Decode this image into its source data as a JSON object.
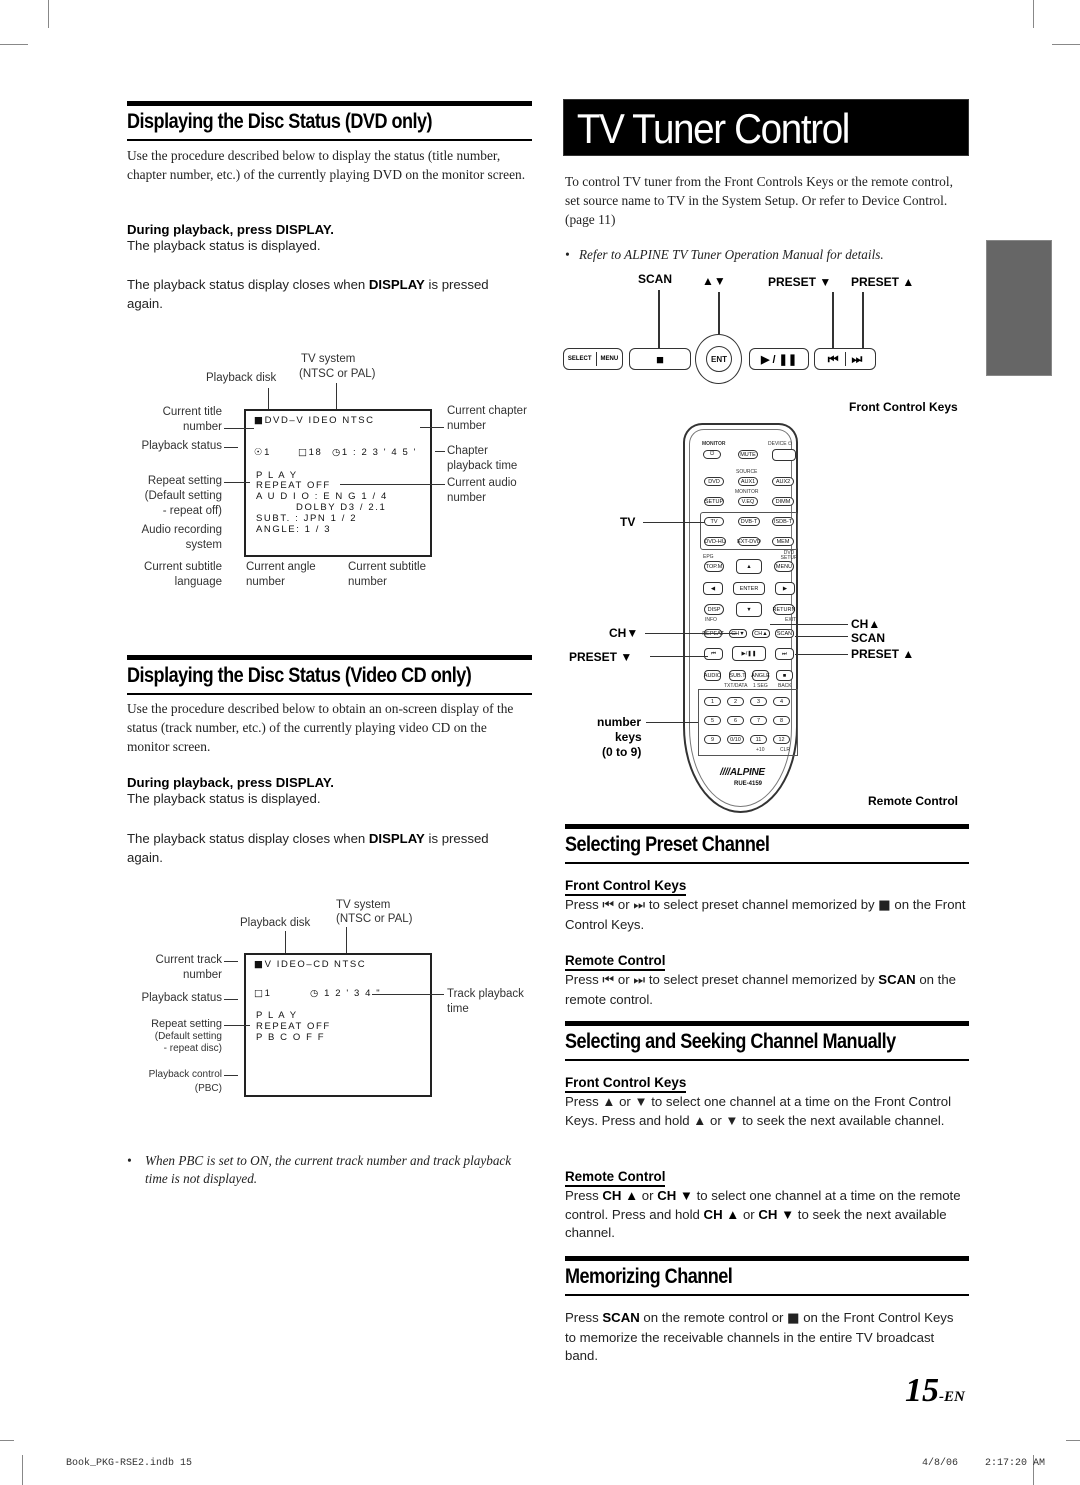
{
  "page": {
    "number": "15",
    "suffix": "-EN"
  },
  "footer": {
    "file": "Book_PKG-RSE2.indb   15",
    "date": "4/8/06",
    "time": "2:17:20 AM"
  },
  "left": {
    "dvd": {
      "heading": "Displaying the Disc Status (DVD only)",
      "intro": "Use the procedure described below to display the status (title number, chapter number, etc.) of the currently playing DVD on the monitor screen.",
      "step_prefix": "During playback, press ",
      "step_key": "DISPLAY.",
      "step_result": "The playback status is displayed.",
      "close_prefix": "The playback status display closes when ",
      "close_key": "DISPLAY",
      "close_suffix": " is pressed again.",
      "diagram": {
        "osd_lines": [
          "DVD–V IDEO  NTSC",
          "1",
          "18",
          "1 : 2 3 ' 4 5 '",
          "P L A Y",
          "REPEAT  OFF",
          "A U D I O : E N G  1 / 4",
          "DOLBY  D3 / 2.1",
          "SUBT. : JPN  1 / 2",
          "ANGLE: 1 / 3"
        ],
        "labels": {
          "tv_system": "TV system",
          "tv_system_sub": "(NTSC or PAL)",
          "playback_disk": "Playback disk",
          "current_title": "Current title",
          "current_title_2": "number",
          "playback_status": "Playback status",
          "repeat_setting": "Repeat setting",
          "repeat_default": "(Default setting",
          "repeat_default_2": "- repeat off)",
          "audio_rec": "Audio recording",
          "audio_rec_2": "system",
          "cur_sub_lang": "Current subtitle",
          "cur_sub_lang_2": "language",
          "cur_angle": "Current angle",
          "cur_angle_2": "number",
          "cur_sub_num": "Current subtitle",
          "cur_sub_num_2": "number",
          "cur_chapter": "Current chapter",
          "cur_chapter_2": "number",
          "chapter_time": "Chapter",
          "chapter_time_2": "playback time",
          "cur_audio": "Current audio",
          "cur_audio_2": "number"
        }
      }
    },
    "vcd": {
      "heading": "Displaying the Disc Status (Video CD only)",
      "intro": "Use the procedure described below to obtain an on-screen display of the status (track number, etc.) of the currently playing video CD on the monitor screen.",
      "step_prefix": "During playback, press ",
      "step_key": "DISPLAY.",
      "step_result": "The playback status is displayed.",
      "close_prefix": "The playback status display closes when ",
      "close_key": "DISPLAY",
      "close_suffix": " is pressed again.",
      "diagram": {
        "osd_lines": [
          "V IDEO–CD",
          "NTSC",
          "1",
          "1 2 ' 3 4 \"",
          "P L A Y",
          "REPEAT  OFF",
          "P B C    O F F"
        ],
        "labels": {
          "tv_system": "TV system",
          "tv_system_sub": "(NTSC or PAL)",
          "playback_disk": "Playback disk",
          "cur_track": "Current track",
          "cur_track_2": "number",
          "playback_status": "Playback status",
          "repeat_setting": "Repeat setting",
          "repeat_default": "(Default setting",
          "repeat_default_2": "- repeat disc)",
          "pbc": "Playback control",
          "pbc_2": "(PBC)",
          "track_time": "Track playback",
          "track_time_2": "time"
        }
      },
      "note": "When PBC is set to ON, the current track number and track playback time is not displayed."
    }
  },
  "right": {
    "title": "TV Tuner Control",
    "intro": "To control TV tuner from the Front Controls Keys or the remote control, set source name to TV in the System Setup. Or refer to Device Control. (page 11)",
    "note": "Refer to ALPINE TV Tuner Operation Manual for details.",
    "front_keys": {
      "caption": "Front Control Keys",
      "labels": {
        "scan": "SCAN",
        "updown": "▲▼",
        "preset_down": "PRESET ▼",
        "preset_up": "PRESET ▲"
      },
      "buttons": {
        "select": "SELECT",
        "menu": "MENU",
        "stop": "■",
        "ent": "ENT",
        "play_pause": "▶ / ❚❚",
        "prev": "⏮",
        "next": "⏭"
      }
    },
    "remote": {
      "caption": "Remote Control",
      "brand": "////ALPINE",
      "model": "RUE-4159",
      "callouts": {
        "tv": "TV",
        "ch_down": "CH▼",
        "preset_down": "PRESET ▼",
        "number_keys": "number",
        "number_keys_2": "keys",
        "number_keys_3": "(0 to 9)",
        "ch_up": "CH▲",
        "scan": "SCAN",
        "preset_up": "PRESET ▲"
      },
      "keys": {
        "monitor": "MONITOR",
        "device": "DEVICE ⏻",
        "power": "⏻",
        "mute": "MUTE",
        "source": "SOURCE",
        "dvd": "DVD",
        "aux1": "AUX1",
        "aux2": "AUX2",
        "monitor2": "MONITOR",
        "setup": "SETUP",
        "veq": "V.EQ",
        "dimm": "DIMM",
        "tv": "TV",
        "dvbt": "DVB-T",
        "isdbt": "ISDB-T",
        "dvdhu": "DVD-HU",
        "extdvd": "EXT-DVD",
        "mem": "MEM",
        "epg": "EPG",
        "dvdsetup": "DVD SETUP",
        "topm": "TOP.M",
        "up": "▲",
        "menu": "MENU",
        "left": "◀",
        "enter": "ENTER",
        "right": "▶",
        "disp": "DISP",
        "down": "▼",
        "return": "RETURN",
        "info": "INFO",
        "exit": "EXIT",
        "repeat": "REPEAT",
        "chdown": "CH▼",
        "chup": "CH▲",
        "scan": "SCAN",
        "prev": "⏮",
        "playpause": "▶/❚❚",
        "next": "⏭",
        "audio": "AUDIO",
        "subt": "SUB.T",
        "angle": "ANGLE",
        "stop": "■",
        "txtdata": "TXT/DATA",
        "oneseg": "1 SEG",
        "back": "BACK",
        "numbers": [
          "1",
          "2",
          "3",
          "4",
          "5",
          "6",
          "7",
          "8",
          "9",
          "0/10",
          "11",
          "12"
        ],
        "plus10": "+10",
        "clr": "CLR"
      }
    },
    "preset": {
      "heading": "Selecting Preset Channel",
      "front_head": "Front Control Keys",
      "front_text_1": "Press ",
      "front_or": " or ",
      "front_text_2": " to select preset channel memorized by ",
      "front_text_3": " on the Front Control Keys.",
      "remote_head": "Remote Control",
      "remote_text_1": "Press ",
      "remote_or": " or ",
      "remote_text_2": " to select preset channel memorized by ",
      "remote_key": "SCAN",
      "remote_text_3": " on the remote control."
    },
    "seek": {
      "heading": "Selecting and Seeking Channel Manually",
      "front_head": "Front Control Keys",
      "front_text": "Press ▲ or ▼  to select one channel at a time on the Front Control Keys. Press and hold ▲ or ▼ to seek the next available channel.",
      "remote_head": "Remote Control",
      "remote_p1": "Press ",
      "remote_k1": "CH ▲",
      "remote_p2": " or ",
      "remote_k2": "CH ▼",
      "remote_p3": " to select one channel at a time on the remote control. Press and hold ",
      "remote_k3": "CH ▲",
      "remote_p4": " or ",
      "remote_k4": "CH ▼",
      "remote_p5": " to seek the next available channel."
    },
    "memorize": {
      "heading": "Memorizing Channel",
      "p1": "Press ",
      "k1": "SCAN",
      "p2": " on the remote control or ",
      "stop": "■",
      "p3": " on the Front Control Keys to memorize the receivable channels in the entire TV broadcast band."
    }
  }
}
